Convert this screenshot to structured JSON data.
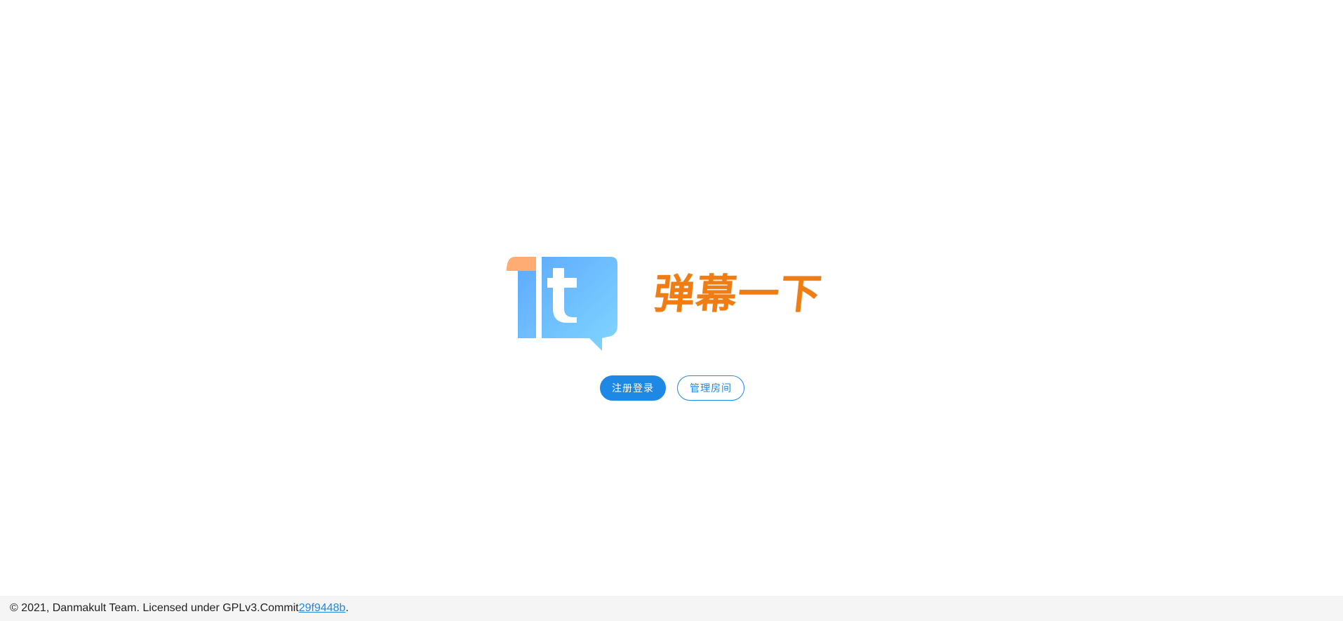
{
  "brand": {
    "title": "弹幕一下",
    "logo_icon": "speech-bubble-it-logo",
    "colors": {
      "title": "#f07d14",
      "logo_orange": "#ffab73",
      "logo_blue_top": "#5ea8ff",
      "logo_blue_bottom": "#7fd6ff"
    }
  },
  "actions": {
    "login_label": "注册登录",
    "manage_label": "管理房间",
    "accent": "#1e88e5"
  },
  "footer": {
    "text": "© 2021, Danmakult Team. Licensed under GPLv3.Commit ",
    "commit_link": "29f9448b",
    "suffix": "."
  }
}
